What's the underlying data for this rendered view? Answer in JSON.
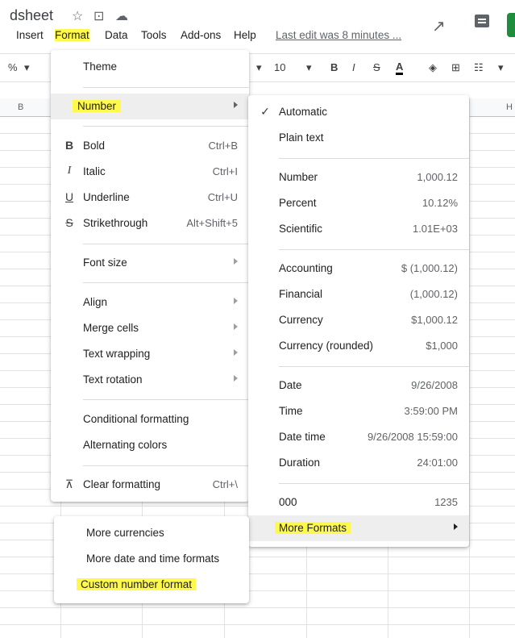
{
  "app": {
    "title": "dsheet",
    "last_edit": "Last edit was 8 minutes ..."
  },
  "menubar": {
    "items": [
      "Insert",
      "Format",
      "Data",
      "Tools",
      "Add-ons",
      "Help"
    ]
  },
  "toolbar": {
    "zoom": "%",
    "font_size": "10",
    "bold": "B",
    "italic": "I",
    "strike": "S",
    "text_color": "A"
  },
  "grid": {
    "col_b": "B",
    "col_h": "H"
  },
  "format_menu": {
    "theme": "Theme",
    "number": "Number",
    "bold": {
      "label": "Bold",
      "shortcut": "Ctrl+B"
    },
    "italic": {
      "label": "Italic",
      "shortcut": "Ctrl+I"
    },
    "underline": {
      "label": "Underline",
      "shortcut": "Ctrl+U"
    },
    "strike": {
      "label": "Strikethrough",
      "shortcut": "Alt+Shift+5"
    },
    "font_size": "Font size",
    "align": "Align",
    "merge": "Merge cells",
    "wrap": "Text wrapping",
    "rotation": "Text rotation",
    "conditional": "Conditional formatting",
    "alternating": "Alternating colors",
    "clear": {
      "label": "Clear formatting",
      "shortcut": "Ctrl+\\"
    }
  },
  "number_menu": {
    "automatic": "Automatic",
    "plain": "Plain text",
    "rows": [
      {
        "label": "Number",
        "value": "1,000.12"
      },
      {
        "label": "Percent",
        "value": "10.12%"
      },
      {
        "label": "Scientific",
        "value": "1.01E+03"
      },
      {
        "label": "Accounting",
        "value": "$ (1,000.12)"
      },
      {
        "label": "Financial",
        "value": "(1,000.12)"
      },
      {
        "label": "Currency",
        "value": "$1,000.12"
      },
      {
        "label": "Currency (rounded)",
        "value": "$1,000"
      },
      {
        "label": "Date",
        "value": "9/26/2008"
      },
      {
        "label": "Time",
        "value": "3:59:00 PM"
      },
      {
        "label": "Date time",
        "value": "9/26/2008 15:59:00"
      },
      {
        "label": "Duration",
        "value": "24:01:00"
      },
      {
        "label": "000",
        "value": "1235"
      }
    ],
    "more": "More Formats"
  },
  "more_menu": {
    "currencies": "More currencies",
    "datetime": "More date and time formats",
    "custom": "Custom number format"
  },
  "colors": {
    "highlight": "#fff94d",
    "share": "#1e8e3e"
  }
}
